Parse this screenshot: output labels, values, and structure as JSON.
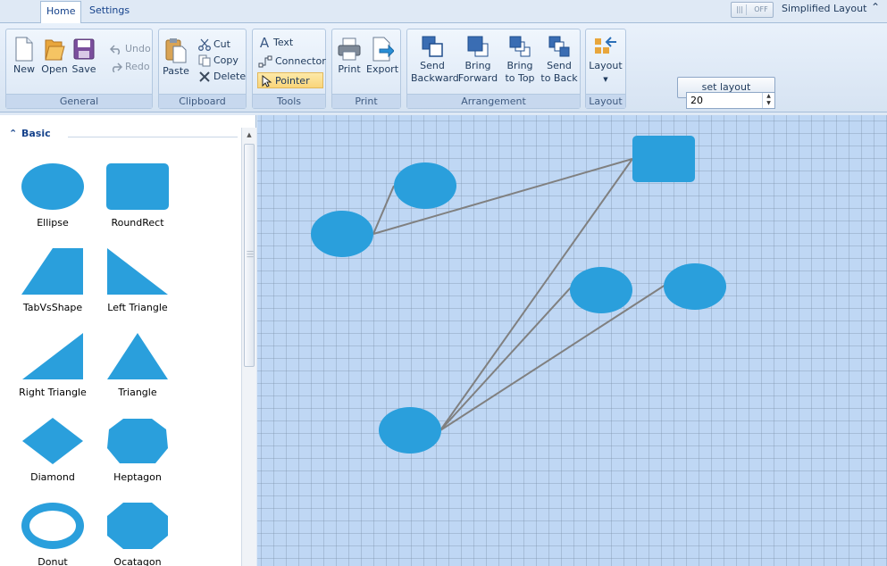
{
  "tabs": [
    {
      "label": "Home",
      "active": true
    },
    {
      "label": "Settings",
      "active": false
    }
  ],
  "simplified_layout": {
    "label": "Simplified Layout",
    "toggle_state": "OFF"
  },
  "ribbon": {
    "groups": {
      "general": "General",
      "clipboard": "Clipboard",
      "tools": "Tools",
      "print": "Print",
      "arrangement": "Arrangement",
      "layout": "Layout"
    },
    "general": {
      "new": "New",
      "open": "Open",
      "save": "Save",
      "undo": "Undo",
      "redo": "Redo"
    },
    "clipboard": {
      "paste": "Paste",
      "cut": "Cut",
      "copy": "Copy",
      "delete": "Delete"
    },
    "tools": {
      "text": "Text",
      "connector": "Connector",
      "pointer": "Pointer"
    },
    "print": {
      "print": "Print",
      "export": "Export"
    },
    "arrangement": {
      "send_backward_1": "Send",
      "send_backward_2": "Backward",
      "bring_forward_1": "Bring",
      "bring_forward_2": "Forward",
      "bring_top_1": "Bring",
      "bring_top_2": "to Top",
      "send_back_1": "Send",
      "send_back_2": "to Back"
    },
    "layout": {
      "label": "Layout"
    },
    "set_layout": "set layout",
    "spin_value": "20"
  },
  "palette": {
    "section": "Basic",
    "shapes": [
      "Ellipse",
      "RoundRect",
      "TabVsShape",
      "Left Triangle",
      "Right Triangle",
      "Triangle",
      "Diamond",
      "Heptagon",
      "Donut",
      "Ocatagon"
    ]
  },
  "colors": {
    "shape_fill": "#2a9fdc",
    "connector": "#808080",
    "canvas_bg": "#bfd7f4",
    "accent": "#15428b"
  }
}
